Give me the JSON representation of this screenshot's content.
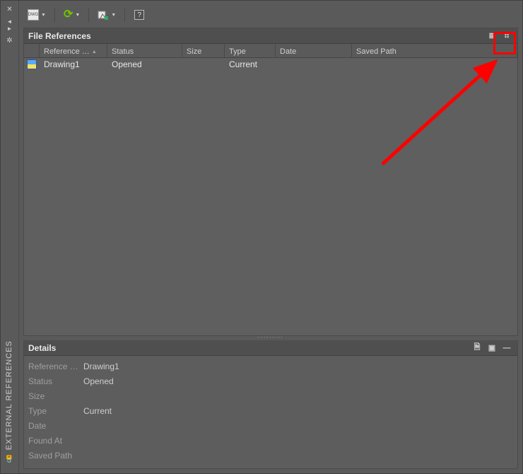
{
  "palette_title": "EXTERNAL REFERENCES",
  "toolbar": {
    "attach_tooltip": "Attach DWG",
    "refresh_tooltip": "Refresh",
    "paths_tooltip": "Change Path",
    "help_tooltip": "Help"
  },
  "file_refs": {
    "title": "File References",
    "columns": {
      "icon": "",
      "ref_name": "Reference …",
      "status": "Status",
      "size": "Size",
      "type": "Type",
      "date": "Date",
      "saved_path": "Saved Path"
    },
    "rows": [
      {
        "name": "Drawing1",
        "status": "Opened",
        "size": "",
        "type": "Current",
        "date": "",
        "saved_path": ""
      }
    ]
  },
  "details": {
    "title": "Details",
    "labels": {
      "ref_name": "Reference …",
      "status": "Status",
      "size": "Size",
      "type": "Type",
      "date": "Date",
      "found_at": "Found At",
      "saved_path": "Saved Path"
    },
    "values": {
      "ref_name": "Drawing1",
      "status": "Opened",
      "size": "",
      "type": "Current",
      "date": "",
      "found_at": "",
      "saved_path": ""
    }
  },
  "glyphs": {
    "close": "✕",
    "arrow_left": "◄",
    "arrow_right": "►",
    "gear": "✲",
    "refresh": "⟳",
    "drop": "▼",
    "sort": "▲",
    "list_view": "≣",
    "tree_view": "⠶",
    "doc": "🗎",
    "pic": "▣",
    "minus": "—",
    "lock": "🔓",
    "question": "?"
  }
}
